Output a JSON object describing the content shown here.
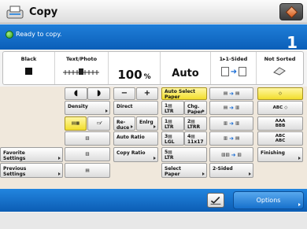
{
  "titlebar": {
    "title": "Copy"
  },
  "status": {
    "message": "Ready to copy.",
    "copies": "1"
  },
  "settings": {
    "color": {
      "label": "Black"
    },
    "density": {
      "label": "Text/Photo"
    },
    "ratio": {
      "value": "100",
      "unit": "%"
    },
    "paper": {
      "value": "Auto"
    },
    "sided": {
      "label": "1▸1-Sided"
    },
    "finishing": {
      "label": "Not Sorted"
    }
  },
  "functions": {
    "density": "Density",
    "direct": "Direct",
    "reduce": "Re-\nduce",
    "enlarge": "Enlrg",
    "auto_ratio": "Auto Ratio",
    "copy_ratio": "Copy Ratio",
    "favorite": "Favorite\nSettings",
    "previous": "Previous\nSettings",
    "auto_select_paper": "Auto Select\nPaper",
    "chg_paper": "Chg.\nPaper",
    "paper1": "LTR",
    "paper2": "LTR",
    "paper2_suffix": "R",
    "paper3": "LGL",
    "paper4": "11x17",
    "paper5": "LTR",
    "select_paper": "Select\nPaper",
    "two_sided": "2-Sided",
    "finishing": "Finishing",
    "finish_abc": "ABC",
    "finish_abc2": "ABC",
    "finish_aaa": "AAA",
    "finish_bbb": "BBB",
    "finish_abc3": "ABC",
    "finish_abc4": "ABC"
  },
  "bottom": {
    "options": "Options"
  },
  "colors": {
    "accent": "#1670cc",
    "selected": "#f2de2c",
    "panel_bg": "#f0e8dc"
  },
  "icons": [
    "copy-icon",
    "tray-icon",
    "ready-icon",
    "density-icon",
    "paper-icon",
    "sided-icon",
    "finishing-icon",
    "check-icon"
  ]
}
